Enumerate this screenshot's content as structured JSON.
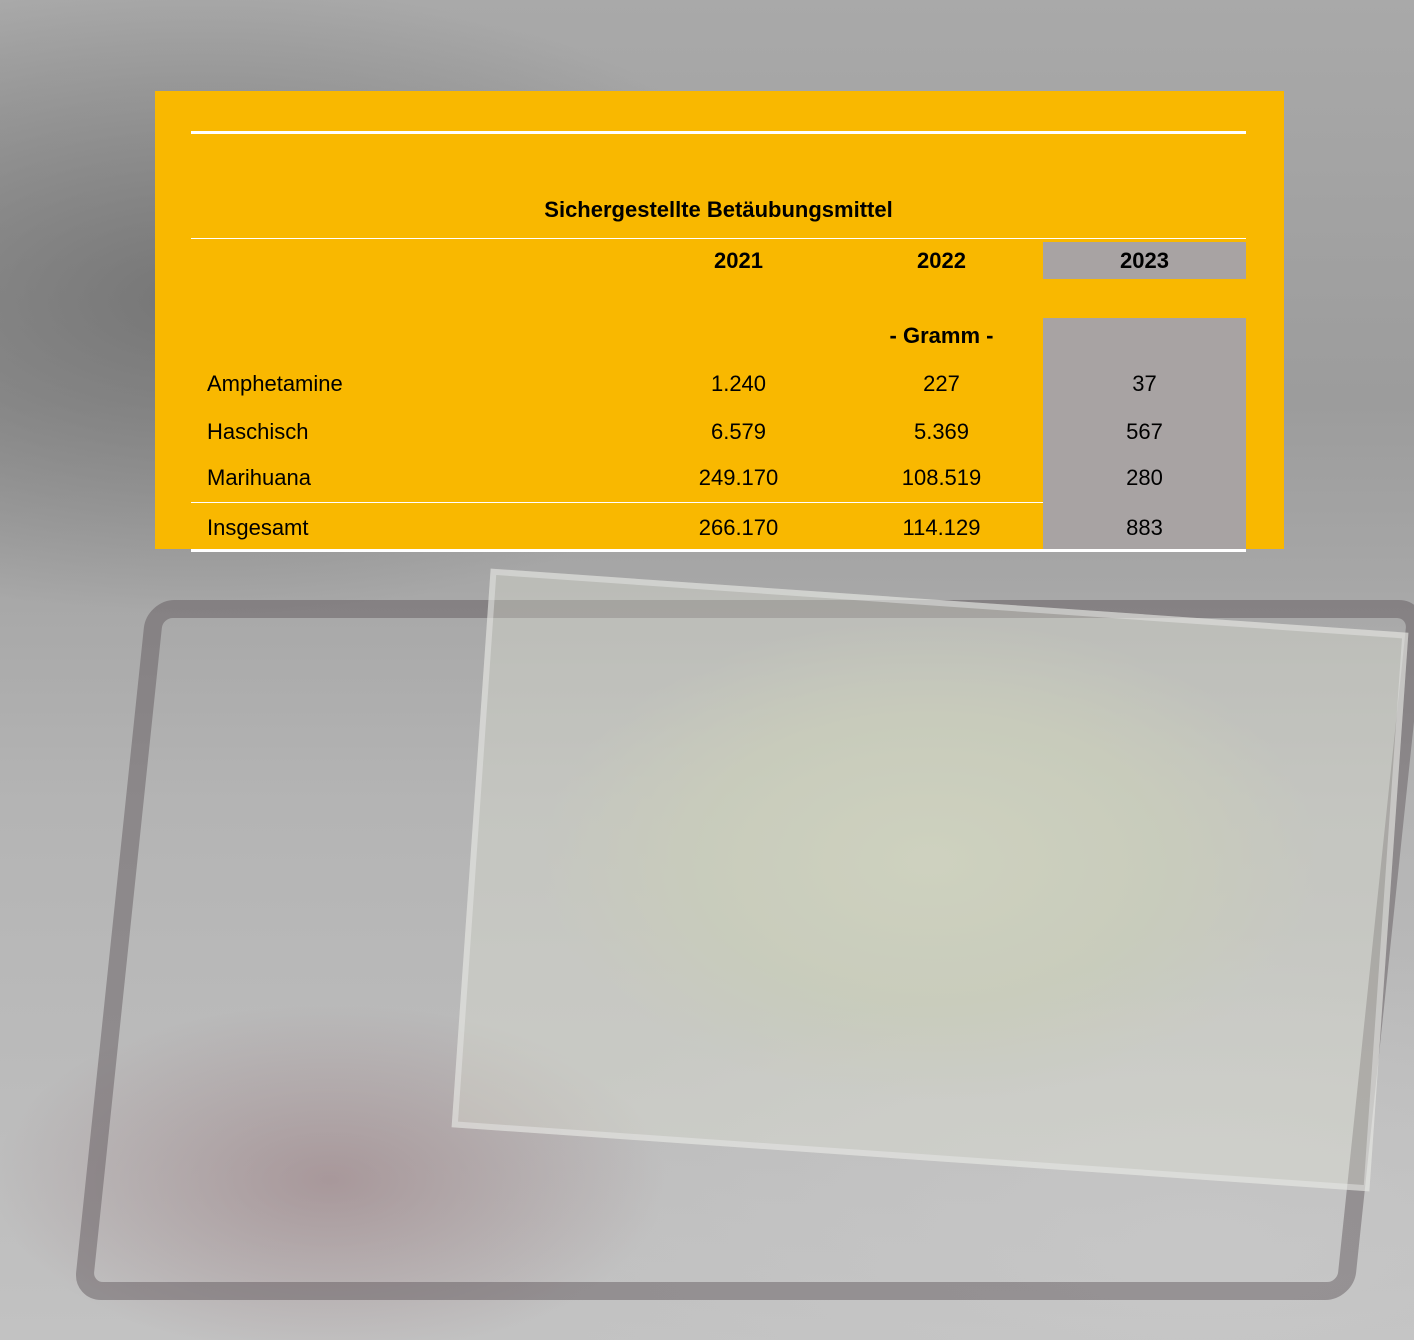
{
  "table": {
    "title": "Sichergestellte Betäubungsmittel",
    "years": [
      "2021",
      "2022",
      "2023"
    ],
    "unit": "- Gramm -",
    "rows": [
      {
        "label": "Amphetamine",
        "values": [
          "1.240",
          "227",
          "37"
        ]
      },
      {
        "label": "Haschisch",
        "values": [
          "6.579",
          "5.369",
          "567"
        ]
      },
      {
        "label": "Marihuana",
        "values": [
          "249.170",
          "108.519",
          "280"
        ]
      }
    ],
    "total": {
      "label": "Insgesamt",
      "values": [
        "266.170",
        "114.129",
        "883"
      ]
    }
  },
  "colors": {
    "panel": "#f9b800",
    "highlight_column": "#a8a3a3",
    "rules": "#ffffff"
  }
}
